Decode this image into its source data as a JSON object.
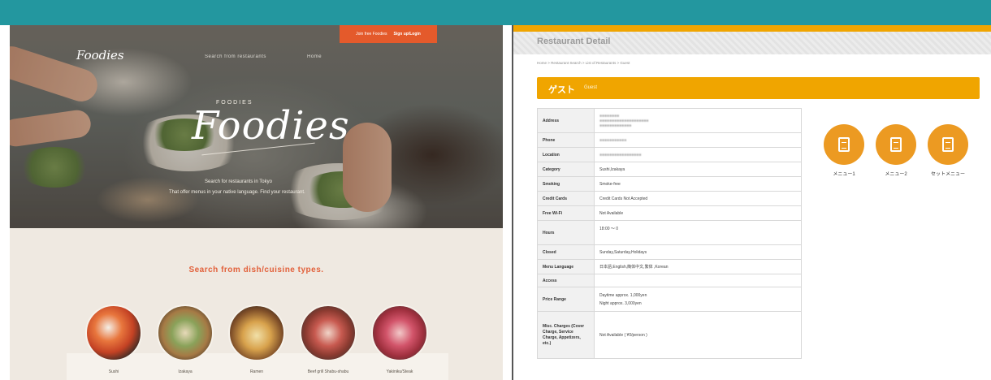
{
  "colors": {
    "top_band": "#23979f",
    "accent_orange": "#f0a500",
    "left_accent": "#e45a2b",
    "search_title": "#e2603a"
  },
  "left": {
    "logo_small": "Foodies",
    "nav": [
      "Search from restaurants",
      "Home"
    ],
    "signin_label": "Join free Foodies",
    "signin_action": "Sign up/Login",
    "brand_sub": "FOODIES",
    "brand": "Foodies",
    "hero_text1": "Search for restaurants in Tokyo",
    "hero_text2": "That offer menus in your native language. Find your restaurant.",
    "search_title": "Search from dish/cuisine types.",
    "dishes": [
      {
        "label": "Sushi",
        "icon": "sushi-photo"
      },
      {
        "label": "Izakaya",
        "icon": "izakaya-photo"
      },
      {
        "label": "Ramen",
        "icon": "ramen-photo"
      },
      {
        "label": "Beef grill Shabu-shabu",
        "icon": "beef-grill-photo"
      },
      {
        "label": "Yakiniku/Steak",
        "icon": "yakiniku-photo"
      }
    ]
  },
  "right": {
    "title": "Restaurant Detail",
    "breadcrumb": "Home > Restaurant Search > List of Restaurants > Guest",
    "name_jp": "ゲスト",
    "name_en": "Guest",
    "rows": [
      {
        "key": "Address",
        "value": "",
        "value2": ""
      },
      {
        "key": "Phone",
        "value": ""
      },
      {
        "key": "Location",
        "value": ""
      },
      {
        "key": "Category",
        "value": "Sushi,Izakaya"
      },
      {
        "key": "Smoking",
        "value": "Smoke-free"
      },
      {
        "key": "Credit Cards",
        "value": "Credit Cards Not Accepted"
      },
      {
        "key": "Free Wi-Fi",
        "value": "Not Available"
      },
      {
        "key": "Hours",
        "value": "18:00 〜 0"
      },
      {
        "key": "Closed",
        "value": "Sunday,Saturday,Holidays"
      },
      {
        "key": "Menu Language",
        "value": "日本語,English,簡体中文,繁体 ,Korean"
      },
      {
        "key": "Access",
        "value": ""
      },
      {
        "key": "Price Range",
        "value": "Daytime approx. 1,000yen",
        "value2": "Night approx. 3,000yen"
      },
      {
        "key": "Misc. Charges (Cover Charge, Service Charge, Appetizers, etc.)",
        "value": "Not Available ( ¥0/person )"
      }
    ],
    "menus": [
      {
        "label": "メニュー1",
        "icon": "menu-document-icon"
      },
      {
        "label": "メニュー2",
        "icon": "menu-document-icon"
      },
      {
        "label": "セットメニュー",
        "icon": "menu-document-icon"
      }
    ]
  }
}
